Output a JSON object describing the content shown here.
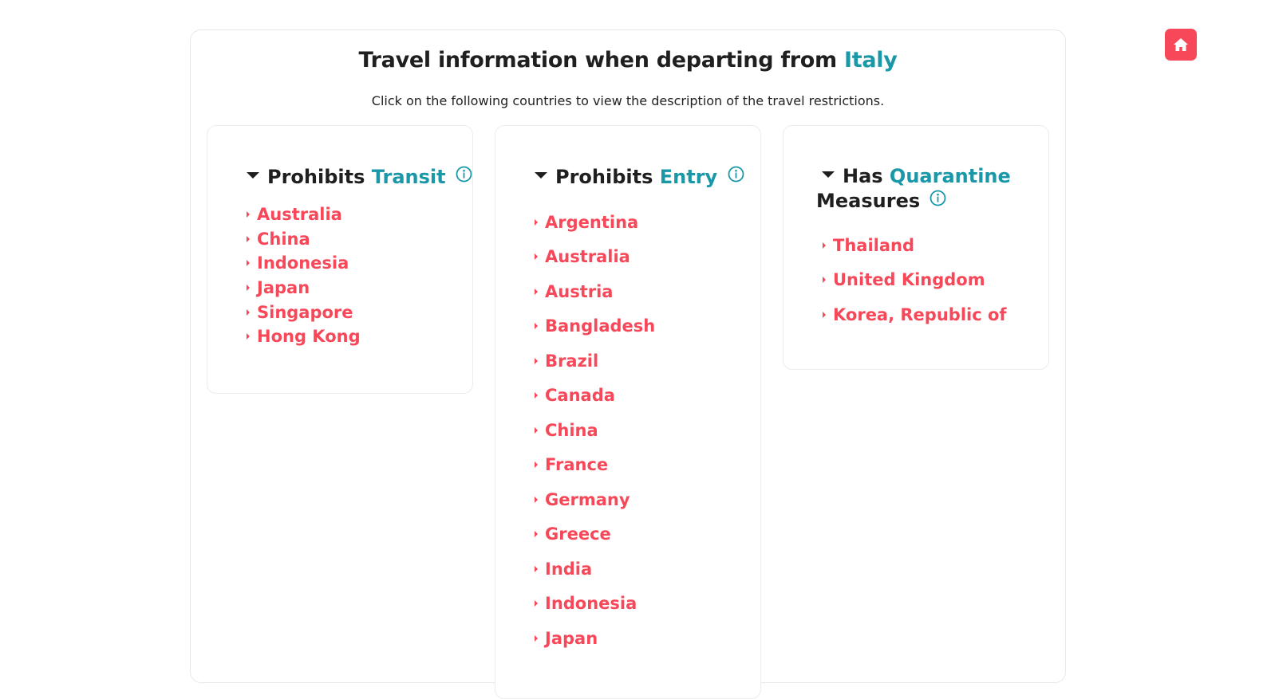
{
  "header": {
    "title_prefix": "Travel information when departing from ",
    "title_country": "Italy",
    "subtitle": "Click on the following countries to view the description of the travel restrictions."
  },
  "colors": {
    "accent": "#1a98a8",
    "country_link": "#f7485a",
    "home_button": "#f7485a"
  },
  "home_button": {
    "icon": "home-icon"
  },
  "transit": {
    "label_prefix": "Prohibits ",
    "label_accent": "Transit",
    "countries": [
      "Australia",
      "China",
      "Indonesia",
      "Japan",
      "Singapore",
      "Hong Kong"
    ]
  },
  "entry": {
    "label_prefix": "Prohibits ",
    "label_accent": "Entry",
    "countries": [
      "Argentina",
      "Australia",
      "Austria",
      "Bangladesh",
      "Brazil",
      "Canada",
      "China",
      "France",
      "Germany",
      "Greece",
      "India",
      "Indonesia",
      "Japan"
    ]
  },
  "quarantine": {
    "label_prefix": "Has ",
    "label_accent": "Quarantine",
    "label_suffix": "Measures",
    "countries": [
      "Thailand",
      "United Kingdom",
      "Korea, Republic of"
    ]
  }
}
